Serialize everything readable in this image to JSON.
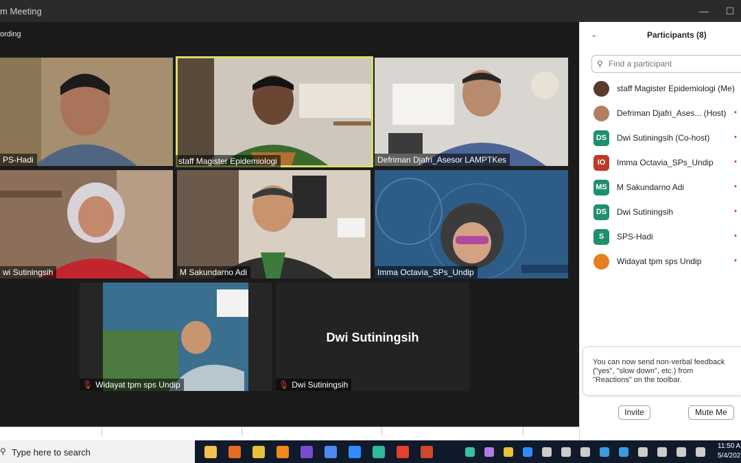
{
  "window": {
    "title": "m Meeting",
    "recording_label": "ording",
    "minimize_icon": "minimize-icon",
    "maximize_icon": "maximize-icon"
  },
  "tiles": [
    {
      "name": "PS-Hadi",
      "bg": "#a58f70"
    },
    {
      "name": "staff Magister Epidemiologi",
      "bg": "#8d8373",
      "active": true
    },
    {
      "name": "Defriman Djafri_Asesor LAMPTKes",
      "bg": "#c9c4bd"
    },
    {
      "name": "wi Sutiningsih",
      "bg": "#8c6f5a"
    },
    {
      "name": "M Sakundarno Adi",
      "bg": "#6b5a4c"
    },
    {
      "name": "Imma Octavia_SPs_Undip",
      "bg": "#2d5c86"
    },
    {
      "name": "Widayat tpm sps Undip",
      "bg": "#3b6f8f",
      "muted": true
    },
    {
      "name": "Dwi Sutiningsih",
      "bg": "#232323",
      "muted": true,
      "display_name": "Dwi Sutiningsih"
    }
  ],
  "panel": {
    "title": "Participants (8)",
    "search_placeholder": "Find a participant",
    "participants": [
      {
        "name": "staff Magister Epidemiologi (Me)",
        "initials": "",
        "color": "#5a3a2a",
        "photo": true
      },
      {
        "name": "Defriman Djafri_Ases...  (Host)",
        "initials": "",
        "color": "#b08060",
        "photo": true
      },
      {
        "name": "Dwi Sutiningsih (Co-host)",
        "initials": "DS",
        "color": "#1f8f6f"
      },
      {
        "name": "Imma Octavia_SPs_Undip",
        "initials": "IO",
        "color": "#c0392b"
      },
      {
        "name": "M Sakundarno Adi",
        "initials": "MS",
        "color": "#1f8f6f"
      },
      {
        "name": "Dwi Sutiningsih",
        "initials": "DS",
        "color": "#1f8f6f"
      },
      {
        "name": "SPS-Hadi",
        "initials": "S",
        "color": "#1f8f6f"
      },
      {
        "name": "Widayat tpm sps Undip",
        "initials": "",
        "color": "#e67e22",
        "photo": true
      }
    ],
    "tip_text": "You can now send non-verbal feedback (\"yes\", \"slow down\", etc.) from \"Reactions\" on the toolbar.",
    "invite_label": "Invite",
    "mute_me_label": "Mute Me"
  },
  "taskbar": {
    "search_placeholder": "Type here to search",
    "apps": [
      {
        "icon": "file-explorer-icon",
        "color": "#f2c14e"
      },
      {
        "icon": "firefox-icon",
        "color": "#e66a21"
      },
      {
        "icon": "app-icon",
        "color": "#e8c23a"
      },
      {
        "icon": "vlc-icon",
        "color": "#f08a1a"
      },
      {
        "icon": "visual-studio-icon",
        "color": "#7a4bd1"
      },
      {
        "icon": "chrome-icon",
        "color": "#4c8bf5"
      },
      {
        "icon": "zoom-icon",
        "color": "#2d8cff"
      },
      {
        "icon": "app-icon",
        "color": "#2dbb9c"
      },
      {
        "icon": "pdf-icon",
        "color": "#e2412b"
      },
      {
        "icon": "powerpoint-icon",
        "color": "#d0482a"
      }
    ],
    "tray": [
      {
        "icon": "tray-icon",
        "color": "#3bbf9e"
      },
      {
        "icon": "tray-icon",
        "color": "#b07ae8"
      },
      {
        "icon": "tray-icon",
        "color": "#e8c23a"
      },
      {
        "icon": "tray-icon",
        "color": "#2d8cff"
      },
      {
        "icon": "usb-icon",
        "color": "#cccccc"
      },
      {
        "icon": "tray-icon",
        "color": "#cccccc"
      },
      {
        "icon": "tray-icon",
        "color": "#cccccc"
      },
      {
        "icon": "tray-icon",
        "color": "#3b9be0"
      },
      {
        "icon": "bluetooth-icon",
        "color": "#3b9be0"
      },
      {
        "icon": "microphone-icon",
        "color": "#cccccc"
      },
      {
        "icon": "battery-icon",
        "color": "#cccccc"
      },
      {
        "icon": "wifi-icon",
        "color": "#cccccc"
      },
      {
        "icon": "volume-icon",
        "color": "#cccccc"
      }
    ],
    "time": "11:50 A",
    "date": "5/4/202"
  }
}
